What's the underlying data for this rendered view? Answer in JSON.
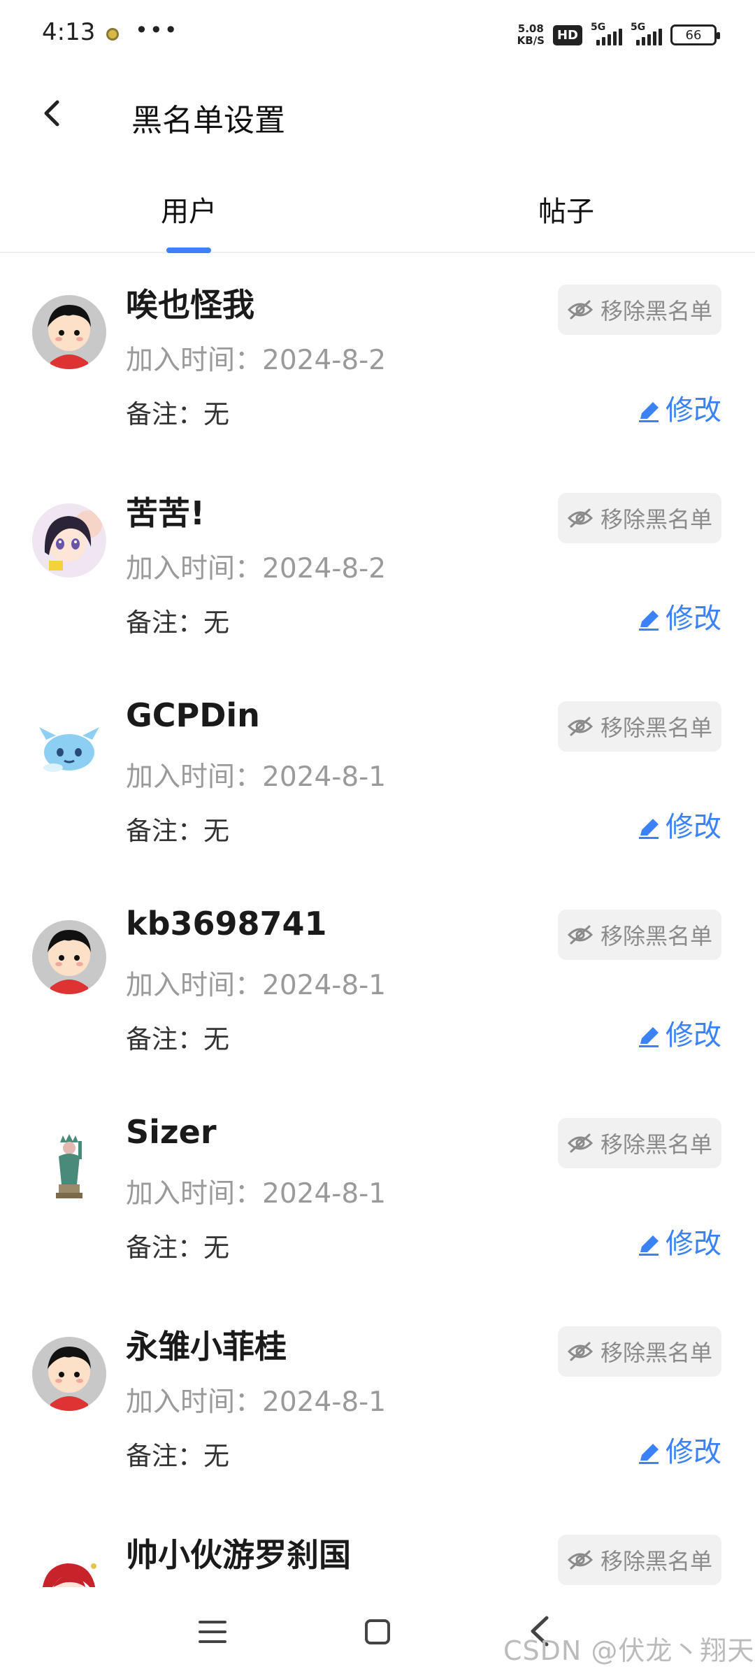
{
  "status_bar": {
    "time": "4:13",
    "net_speed_value": "5.08",
    "net_speed_unit": "KB/S",
    "hd_label": "HD",
    "signal1_label": "5G",
    "signal2_label": "5G",
    "battery": "66"
  },
  "header": {
    "title": "黑名单设置"
  },
  "tabs": [
    {
      "label": "用户",
      "active": true
    },
    {
      "label": "帖子",
      "active": false
    }
  ],
  "items": [
    {
      "name": "唉也怪我",
      "date": "加入时间：2024-8-2",
      "note": "备注：无",
      "remove_label": "移除黑名单",
      "edit_label": "修改",
      "avatar": "default-boy"
    },
    {
      "name": "苦苦!",
      "date": "加入时间：2024-8-2",
      "note": "备注：无",
      "remove_label": "移除黑名单",
      "edit_label": "修改",
      "avatar": "anime-girl"
    },
    {
      "name": "GCPDin",
      "date": "加入时间：2024-8-1",
      "note": "备注：无",
      "remove_label": "移除黑名单",
      "edit_label": "修改",
      "avatar": "blue-creature"
    },
    {
      "name": "kb3698741",
      "date": "加入时间：2024-8-1",
      "note": "备注：无",
      "remove_label": "移除黑名单",
      "edit_label": "修改",
      "avatar": "default-boy"
    },
    {
      "name": "Sizer",
      "date": "加入时间：2024-8-1",
      "note": "备注：无",
      "remove_label": "移除黑名单",
      "edit_label": "修改",
      "avatar": "statue"
    },
    {
      "name": "永雏小菲桂",
      "date": "加入时间：2024-8-1",
      "note": "备注：无",
      "remove_label": "移除黑名单",
      "edit_label": "修改",
      "avatar": "default-boy"
    },
    {
      "name": "帅小伙游罗刹国",
      "date": "",
      "note": "",
      "remove_label": "移除黑名单",
      "edit_label": "",
      "avatar": "red-hair"
    }
  ],
  "watermark": "CSDN @伏龙丶翔天",
  "colors": {
    "accent": "#3b82f6",
    "button_bg": "#f1f1f1",
    "muted_text": "#9a9a9a"
  }
}
